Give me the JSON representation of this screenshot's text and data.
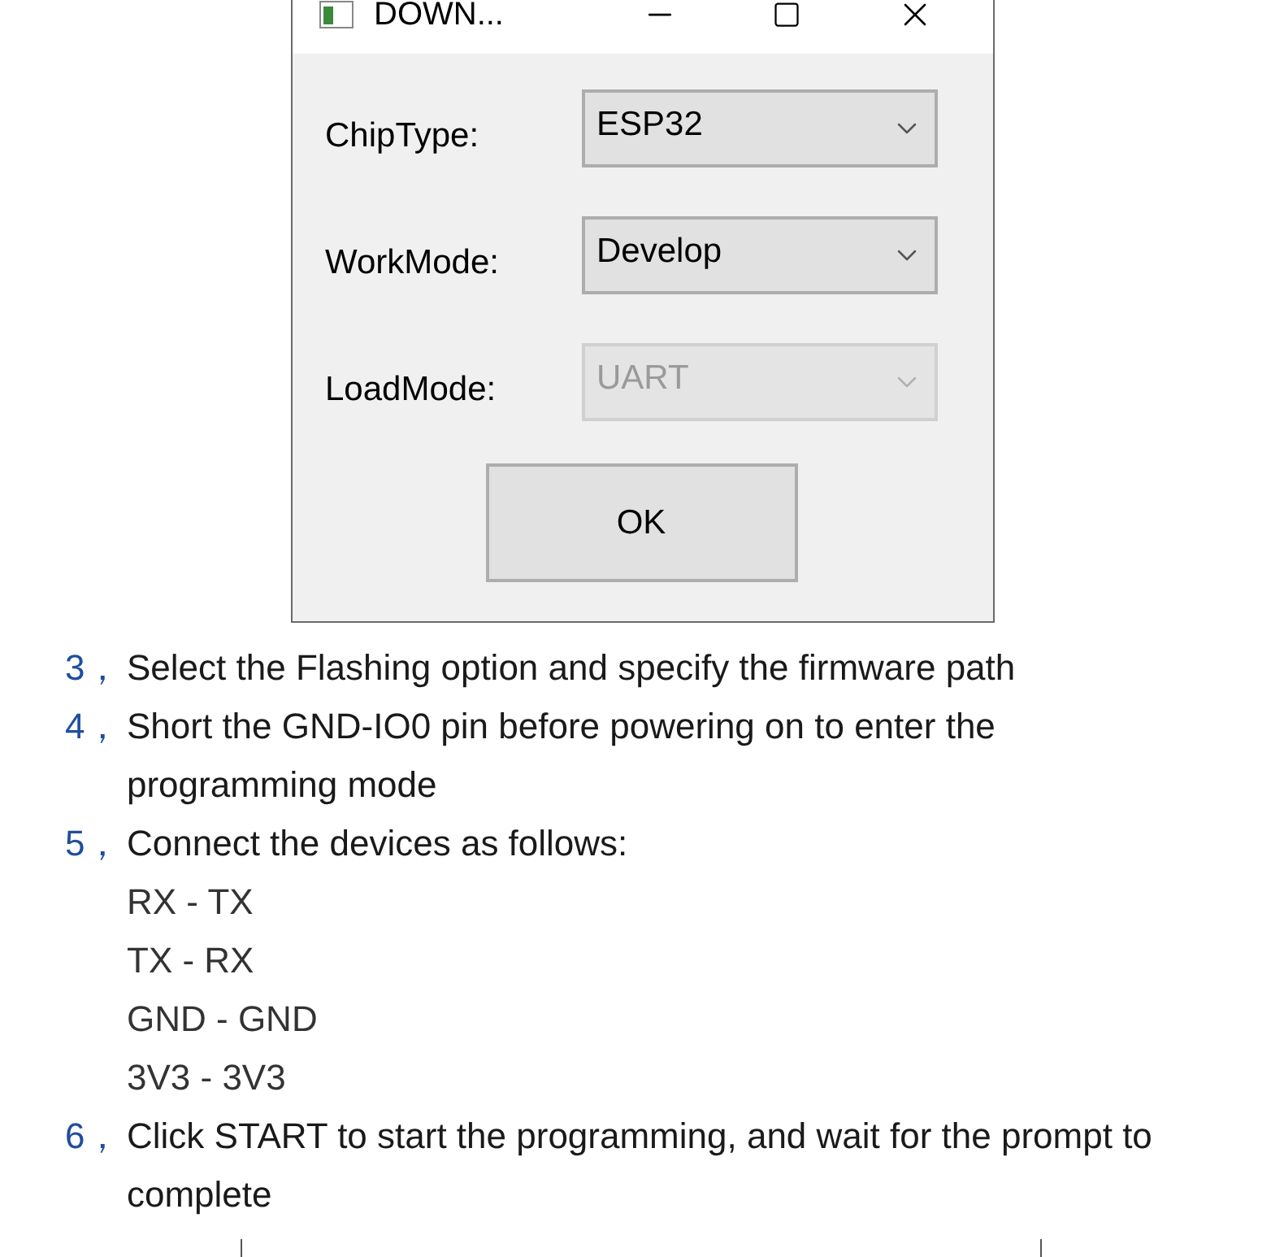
{
  "window": {
    "title": "DOWN..."
  },
  "fields": [
    {
      "label": "ChipType:",
      "value": "ESP32",
      "disabled": false
    },
    {
      "label": "WorkMode:",
      "value": "Develop",
      "disabled": false
    },
    {
      "label": "LoadMode:",
      "value": "UART",
      "disabled": true
    }
  ],
  "ok_button": "OK",
  "steps": [
    {
      "number": "3，",
      "text": "Select the Flashing option and specify the firmware path"
    },
    {
      "number": "4，",
      "text": "Short the GND-IO0 pin before powering on to enter the programming mode"
    },
    {
      "number": "5，",
      "text": "Connect the devices as follows:",
      "sub_items": [
        "RX - TX",
        "TX - RX",
        "GND - GND",
        "3V3 - 3V3"
      ]
    },
    {
      "number": "6，",
      "text": "Click START to start the programming, and wait for the prompt to complete"
    }
  ]
}
